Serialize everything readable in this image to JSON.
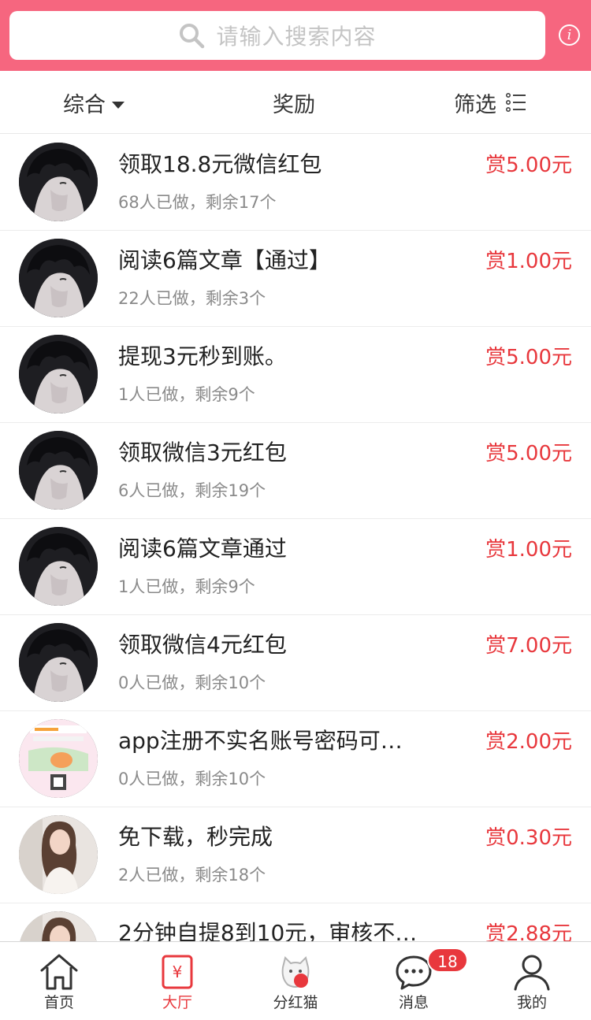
{
  "search": {
    "placeholder": "请输入搜索内容"
  },
  "filters": [
    {
      "label": "综合"
    },
    {
      "label": "奖励"
    },
    {
      "label": "筛选"
    }
  ],
  "tasks": [
    {
      "title": "领取18.8元微信红包",
      "meta": "68人已做，剩余17个",
      "reward": "赏5.00元",
      "avatar": "anime-avatar"
    },
    {
      "title": "阅读6篇文章【通过】",
      "meta": "22人已做，剩余3个",
      "reward": "赏1.00元",
      "avatar": "anime-avatar"
    },
    {
      "title": "提现3元秒到账。",
      "meta": "1人已做，剩余9个",
      "reward": "赏5.00元",
      "avatar": "anime-avatar"
    },
    {
      "title": "领取微信3元红包",
      "meta": "6人已做，剩余19个",
      "reward": "赏5.00元",
      "avatar": "anime-avatar"
    },
    {
      "title": "阅读6篇文章通过",
      "meta": "1人已做，剩余9个",
      "reward": "赏1.00元",
      "avatar": "anime-avatar"
    },
    {
      "title": "领取微信4元红包",
      "meta": "0人已做，剩余10个",
      "reward": "赏7.00元",
      "avatar": "anime-avatar"
    },
    {
      "title": "app注册不实名账号密码可…",
      "meta": "0人已做，剩余10个",
      "reward": "赏2.00元",
      "avatar": "promo-poster"
    },
    {
      "title": "免下载，秒完成",
      "meta": "2人已做，剩余18个",
      "reward": "赏0.30元",
      "avatar": "girl-photo"
    },
    {
      "title": "2分钟自提8到10元，审核不…",
      "meta": "",
      "reward": "赏2.88元",
      "avatar": "girl-photo"
    }
  ],
  "tabs": [
    {
      "label": "首页",
      "icon": "home-icon"
    },
    {
      "label": "大厅",
      "icon": "hall-icon"
    },
    {
      "label": "分红猫",
      "icon": "cat-icon"
    },
    {
      "label": "消息",
      "icon": "message-icon",
      "badge": "18"
    },
    {
      "label": "我的",
      "icon": "user-icon"
    }
  ],
  "colors": {
    "brand": "#f6667f",
    "reward": "#e8383d",
    "meta": "#8a8a8a"
  }
}
